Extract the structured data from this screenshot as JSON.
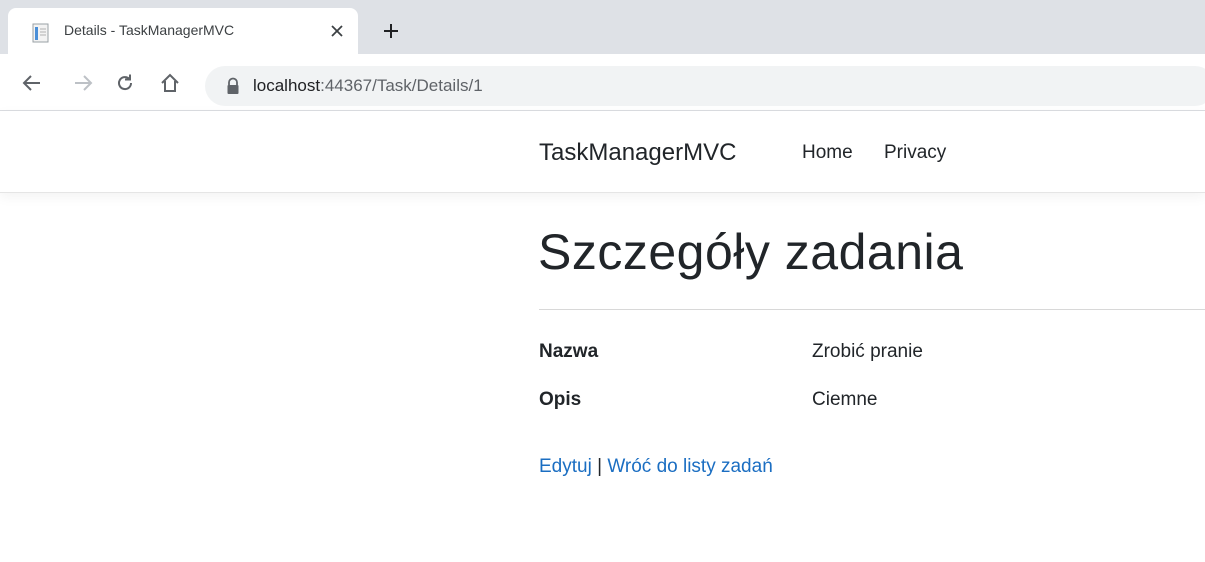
{
  "browser": {
    "tab_title": "Details - TaskManagerMVC",
    "new_tab_icon": "plus-icon",
    "url_host": "localhost",
    "url_path": ":44367/Task/Details/1"
  },
  "navbar": {
    "brand": "TaskManagerMVC",
    "links": [
      "Home",
      "Privacy"
    ]
  },
  "main": {
    "title": "Szczegóły zadania",
    "fields": [
      {
        "label": "Nazwa",
        "value": "Zrobić pranie"
      },
      {
        "label": "Opis",
        "value": "Ciemne"
      }
    ],
    "actions": {
      "edit": "Edytuj",
      "separator": "|",
      "back": "Wróć do listy zadań"
    }
  },
  "colors": {
    "link": "#1b6ec2",
    "text": "#212529",
    "tabstrip": "#dee1e6",
    "omnibox": "#f1f3f4"
  }
}
